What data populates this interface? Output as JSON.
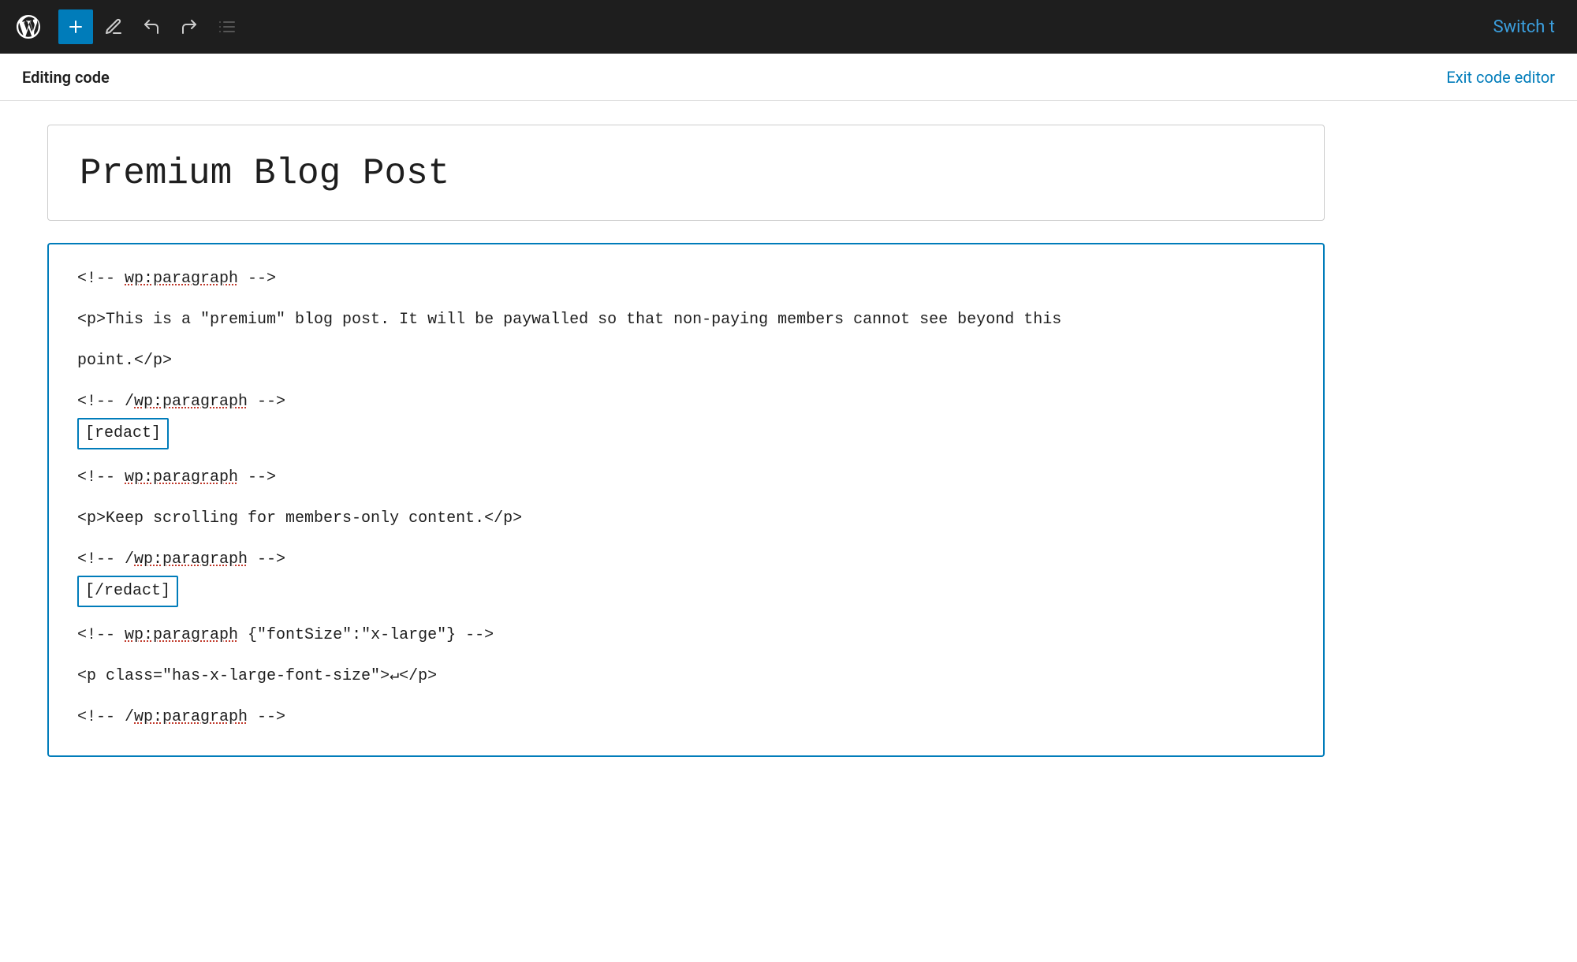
{
  "toolbar": {
    "add_label": "+",
    "switch_label": "Switch t"
  },
  "editing_bar": {
    "label": "Editing code",
    "exit_label": "Exit code editor"
  },
  "post": {
    "title": "Premium Blog Post"
  },
  "code_editor": {
    "lines": [
      {
        "type": "comment",
        "text": "<!-- ",
        "tag": "wp:paragraph",
        "end": " -->"
      },
      {
        "type": "spacer"
      },
      {
        "type": "code",
        "text": "<p>This is a \"premium\" blog post. It will be paywalled so that non-paying members cannot see beyond this"
      },
      {
        "type": "spacer"
      },
      {
        "type": "code",
        "text": "point.</p>"
      },
      {
        "type": "spacer"
      },
      {
        "type": "comment",
        "text": "<!-- /",
        "tag": "wp:paragraph",
        "end": " -->"
      },
      {
        "type": "shortcode",
        "text": "[redact]"
      },
      {
        "type": "spacer"
      },
      {
        "type": "comment",
        "text": "<!-- ",
        "tag": "wp:paragraph",
        "end": " -->"
      },
      {
        "type": "spacer"
      },
      {
        "type": "code",
        "text": "<p>Keep scrolling for members-only content.</p>"
      },
      {
        "type": "spacer"
      },
      {
        "type": "comment",
        "text": "<!-- /",
        "tag": "wp:paragraph",
        "end": " -->"
      },
      {
        "type": "shortcode",
        "text": "[/redact]"
      },
      {
        "type": "spacer"
      },
      {
        "type": "comment",
        "text": "<!-- ",
        "tag": "wp:paragraph",
        "end": " {\"fontSize\":\"x-large\"} -->"
      },
      {
        "type": "spacer"
      },
      {
        "type": "code",
        "text": "<p class=\"has-x-large-font-size\">↵</p>"
      },
      {
        "type": "spacer"
      },
      {
        "type": "comment",
        "text": "<!-- /",
        "tag": "wp:paragraph",
        "end": " -->"
      }
    ]
  }
}
